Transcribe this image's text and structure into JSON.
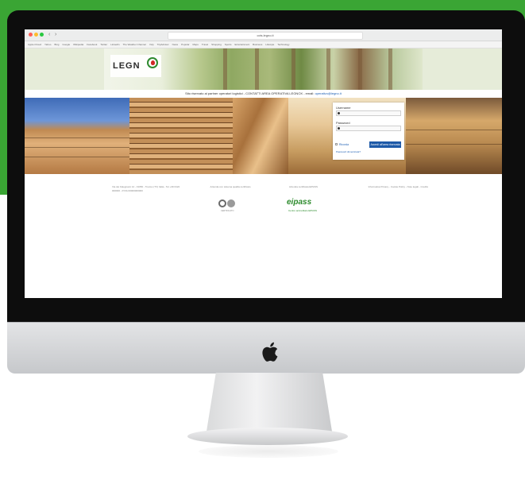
{
  "browser": {
    "url": "ccts.legno.it",
    "nav_back": "‹",
    "nav_forward": "›",
    "bookmarks": [
      "Apple iCloud",
      "Yahoo",
      "Bing",
      "Google",
      "Wikipedia",
      "Facebook",
      "Twitter",
      "LinkedIn",
      "The Weather Channel",
      "Yelp",
      "TripAdvisor",
      "News",
      "Popular",
      "Maps",
      "Travel",
      "Shopping",
      "Sports",
      "Entertainment",
      "Business",
      "Lifestyle",
      "Technology"
    ]
  },
  "site": {
    "logo_text": "LEGN",
    "info_text": "Sito riservato ai partner operatori logistici - CONTATTI AREA OPERATIVA LEGNOX - email: ",
    "info_email": "operativo@legno.it"
  },
  "login": {
    "username_label": "Username",
    "password_label": "Password",
    "remember_label": "Ricorda",
    "submit_label": "Accedi all'area riservata",
    "forgot_label": "Password dimenticata?"
  },
  "footer": {
    "col1": "Via dei Falegnami 12 - 31050 - Treviso (TV) Italia - Tel +39 0422 000000 - P.IVA 00000000000",
    "col2": "Azienda con sistema qualità certificato",
    "col3": "Azienda certificata EIPASS",
    "col4": "Informativa Privacy - Cookie Policy - Note legali - Credits",
    "cert_label": "CERTIFICATO",
    "eipass_logo": "eipass",
    "eipass_sub": "Centro accreditato EIPASS"
  },
  "colors": {
    "page_green": "#3aa534",
    "login_button": "#1e5aa8",
    "link_blue": "#1d5fb4"
  }
}
